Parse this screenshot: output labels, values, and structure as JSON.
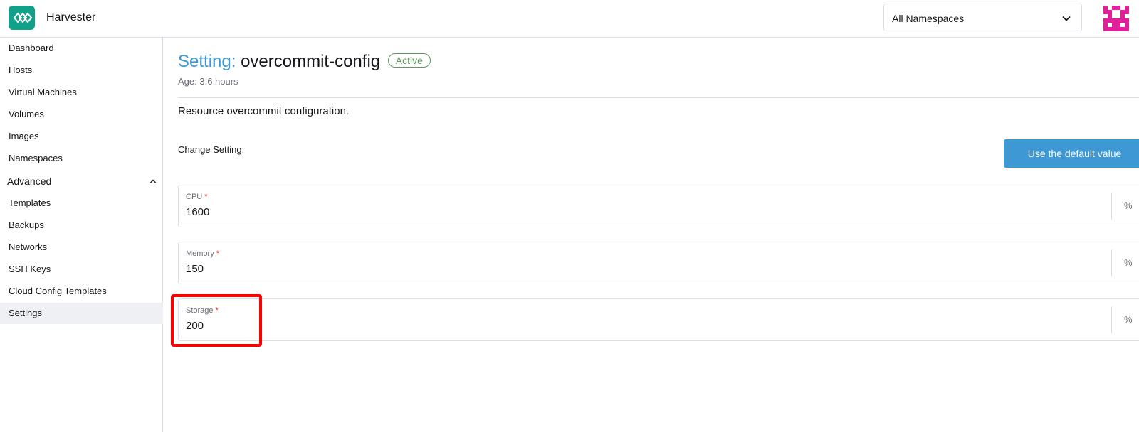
{
  "header": {
    "app_name": "Harvester",
    "namespace_select": {
      "value": "All Namespaces"
    },
    "colors": {
      "logo_bg": "#12a08a",
      "avatar": "#e01f9b"
    }
  },
  "sidebar": {
    "items_top": [
      {
        "label": "Dashboard"
      },
      {
        "label": "Hosts"
      },
      {
        "label": "Virtual Machines"
      },
      {
        "label": "Volumes"
      },
      {
        "label": "Images"
      },
      {
        "label": "Namespaces"
      }
    ],
    "group": {
      "label": "Advanced",
      "expanded": true
    },
    "items_advanced": [
      {
        "label": "Templates"
      },
      {
        "label": "Backups"
      },
      {
        "label": "Networks"
      },
      {
        "label": "SSH Keys"
      },
      {
        "label": "Cloud Config Templates"
      },
      {
        "label": "Settings",
        "active": true
      }
    ]
  },
  "main": {
    "title_prefix": "Setting:",
    "title_name": "overcommit-config",
    "status_badge": "Active",
    "age": "Age: 3.6 hours",
    "description": "Resource overcommit configuration.",
    "change_label": "Change Setting:",
    "default_button": "Use the default value",
    "fields": {
      "cpu": {
        "label": "CPU",
        "required": "*",
        "value": "1600",
        "suffix": "%"
      },
      "memory": {
        "label": "Memory",
        "required": "*",
        "value": "150",
        "suffix": "%"
      },
      "storage": {
        "label": "Storage",
        "required": "*",
        "value": "200",
        "suffix": "%"
      }
    },
    "colors": {
      "accent": "#3d98d3",
      "active_badge": "#5d995d",
      "required": "#e22b2b",
      "highlight": "#ff0000"
    }
  }
}
